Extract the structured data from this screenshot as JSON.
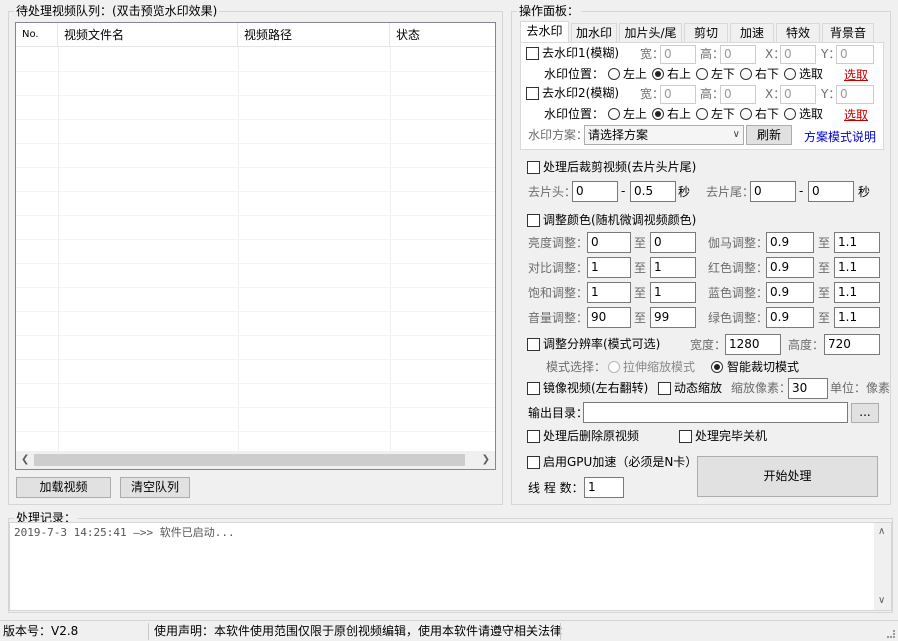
{
  "queue": {
    "title": "待处理视频队列：(双击预览水印效果)",
    "columns": [
      "No.",
      "视频文件名",
      "视频路径",
      "状态"
    ],
    "load_button": "加载视频",
    "clear_button": "清空队列"
  },
  "panel": {
    "title": "操作面板：",
    "tabs": [
      "去水印",
      "加水印",
      "加片头/尾",
      "剪切",
      "加速",
      "特效",
      "背景音"
    ],
    "wm1": {
      "label": "去水印1(模糊)",
      "w_label": "宽：",
      "w_val": "0",
      "h_label": "高：",
      "h_val": "0",
      "x_label": "X：",
      "x_val": "0",
      "y_label": "Y：",
      "y_val": "0",
      "pos_label": "水印位置：",
      "positions": [
        "左上",
        "右上",
        "左下",
        "右下",
        "选取"
      ],
      "pick_link": "选取"
    },
    "wm2": {
      "label": "去水印2(模糊)",
      "w_label": "宽：",
      "w_val": "0",
      "h_label": "高：",
      "h_val": "0",
      "x_label": "X：",
      "x_val": "0",
      "y_label": "Y：",
      "y_val": "0",
      "pos_label": "水印位置：",
      "positions": [
        "左上",
        "右上",
        "左下",
        "右下",
        "选取"
      ],
      "pick_link": "选取"
    },
    "scheme": {
      "label": "水印方案：",
      "selected": "请选择方案",
      "refresh": "刷新",
      "help": "方案模式说明"
    },
    "trim": {
      "label": "处理后裁剪视频(去片头片尾)",
      "head_label": "去片头：",
      "head_from": "0",
      "head_to": "0.5",
      "head_unit": "秒",
      "tail_label": "去片尾：",
      "tail_from": "0",
      "tail_to": "0",
      "tail_unit": "秒",
      "dash": "-"
    },
    "color": {
      "label": "调整颜色(随机微调视频颜色)",
      "to": "至",
      "left": [
        {
          "name": "亮度调整：",
          "from": "0",
          "to": "0"
        },
        {
          "name": "对比调整：",
          "from": "1",
          "to": "1"
        },
        {
          "name": "饱和调整：",
          "from": "1",
          "to": "1"
        },
        {
          "name": "音量调整：",
          "from": "90",
          "to": "99"
        }
      ],
      "right": [
        {
          "name": "伽马调整：",
          "from": "0.9",
          "to": "1.1"
        },
        {
          "name": "红色调整：",
          "from": "0.9",
          "to": "1.1"
        },
        {
          "name": "蓝色调整：",
          "from": "0.9",
          "to": "1.1"
        },
        {
          "name": "绿色调整：",
          "from": "0.9",
          "to": "1.1"
        }
      ]
    },
    "resolution": {
      "label": "调整分辨率(模式可选)",
      "w_label": "宽度：",
      "w_val": "1280",
      "h_label": "高度：",
      "h_val": "720",
      "mode_label": "模式选择：",
      "mode_stretch": "拉伸缩放模式",
      "mode_crop": "智能裁切模式"
    },
    "mirror": {
      "label": "镜像视频(左右翻转)",
      "zoom_label": "动态缩放",
      "zoom_px_label": "缩放像素：",
      "zoom_px_val": "30",
      "unit_label": "单位：像素"
    },
    "output": {
      "label": "输出目录：",
      "value": "",
      "browse": "..."
    },
    "delete_source": "处理后删除原视频",
    "shutdown": "处理完毕关机",
    "gpu": "启用GPU加速（必须是N卡）",
    "threads_label": "线 程 数：",
    "threads_val": "1",
    "start": "开始处理"
  },
  "log": {
    "title": "处理记录：",
    "entries": [
      "2019-7-3 14:25:41 —>> 软件已启动..."
    ]
  },
  "status": {
    "version": "版本号：V2.8",
    "notice": "使用声明：本软件使用范围仅限于原创视频编辑，使用本软件请遵守相关法律"
  }
}
